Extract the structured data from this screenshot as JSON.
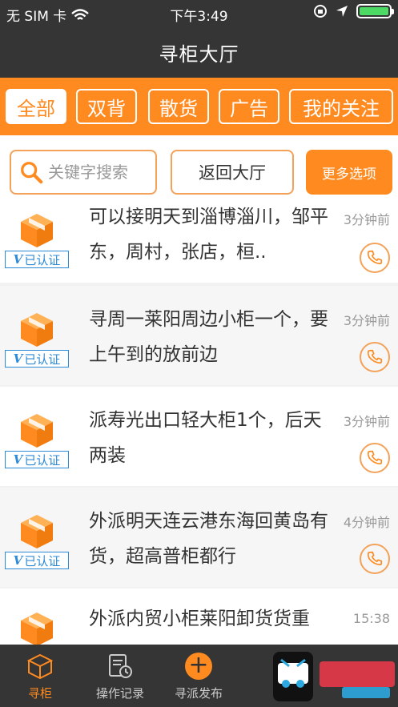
{
  "status_bar": {
    "carrier": "无 SIM 卡",
    "time": "下午3:49"
  },
  "header": {
    "title": "寻柜大厅"
  },
  "tabs": [
    "全部",
    "双背",
    "散货",
    "广告",
    "我的关注"
  ],
  "filters": {
    "search_placeholder": "关键字搜索",
    "back_label": "返回大厅",
    "more_label": "更多选项"
  },
  "list": [
    {
      "text": "可以接明天到淄博淄川，邹平东，周村，张店，桓..",
      "time": "3分钟前",
      "badge": "已认证"
    },
    {
      "text": "寻周一莱阳周边小柜一个，要上午到的放前边",
      "time": "3分钟前",
      "badge": "已认证"
    },
    {
      "text": "派寿光出口轻大柜1个，后天两装",
      "time": "3分钟前",
      "badge": "已认证"
    },
    {
      "text": "外派明天连云港东海回黄岛有货，超高普柜都行",
      "time": "4分钟前",
      "badge": "已认证"
    },
    {
      "text": "外派内贸小柜莱阳卸货货重",
      "time": "15:38",
      "badge": ""
    }
  ],
  "bottom_nav": [
    "寻柜",
    "操作记录",
    "寻派发布"
  ],
  "colors": {
    "accent": "#ff8a1f",
    "dark": "#353535",
    "verified": "#2c8ad6"
  }
}
